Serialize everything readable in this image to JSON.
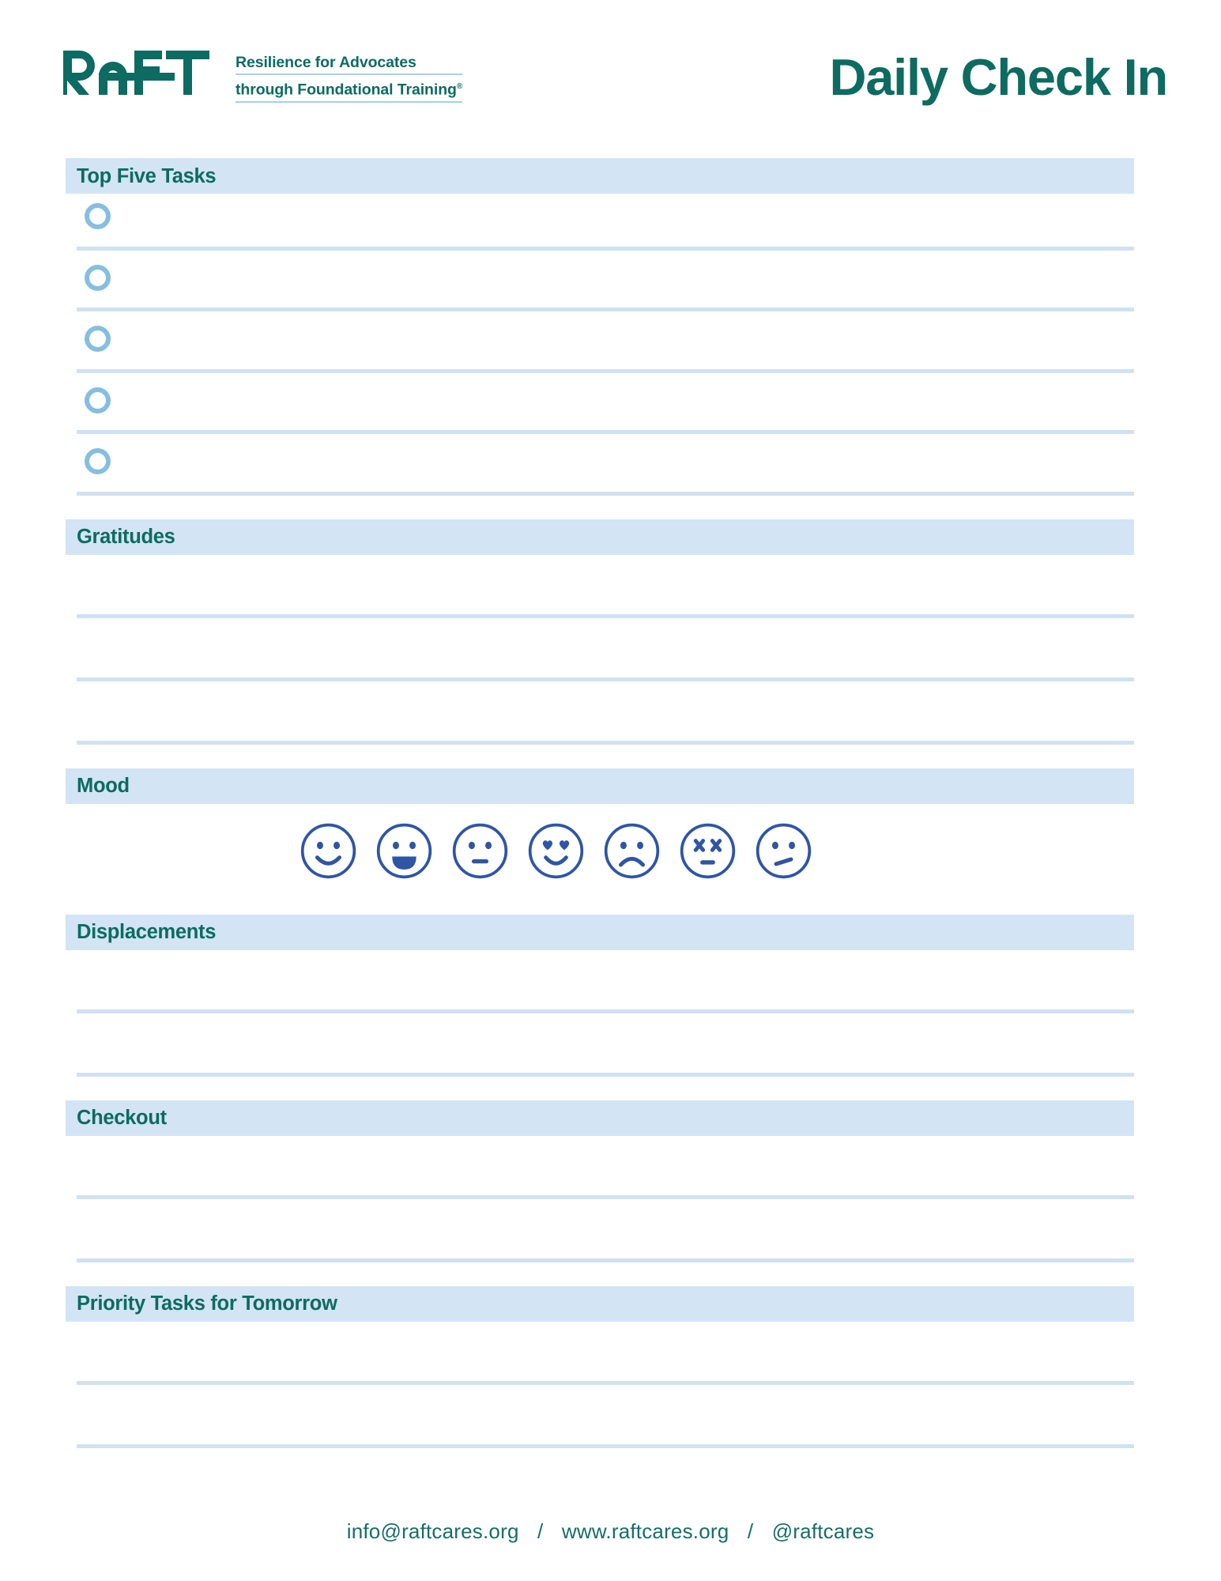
{
  "document": {
    "title": "Daily Check In",
    "accent_green": "#0d6b61",
    "band_blue": "#d3e4f4",
    "rule_blue": "#cfe2f2",
    "circle_blue": "#86bee0",
    "face_blue": "#2f55a4"
  },
  "logo": {
    "wordmark": "RAFT",
    "tagline_line1": "Resilience for Advocates",
    "tagline_line2": "through Foundational Training",
    "registered_mark": "®"
  },
  "sections": {
    "top_five_tasks": {
      "heading": "Top Five Tasks",
      "rows": 5
    },
    "gratitudes": {
      "heading": "Gratitudes",
      "lines": 3
    },
    "mood": {
      "heading": "Mood",
      "faces": [
        {
          "name": "smiling-face",
          "label": "Smiling"
        },
        {
          "name": "grinning-face",
          "label": "Grinning"
        },
        {
          "name": "neutral-face",
          "label": "Neutral"
        },
        {
          "name": "heart-eyes-face",
          "label": "Heart Eyes"
        },
        {
          "name": "frowning-face",
          "label": "Frowning"
        },
        {
          "name": "dizzy-face",
          "label": "Dizzy"
        },
        {
          "name": "confused-face",
          "label": "Confused"
        }
      ]
    },
    "displacements": {
      "heading": "Displacements",
      "lines": 2
    },
    "checkout": {
      "heading": "Checkout",
      "lines": 2
    },
    "priority_tasks_tomorrow": {
      "heading": "Priority Tasks for Tomorrow",
      "lines": 2
    }
  },
  "footer": {
    "email": "info@raftcares.org",
    "separator": "/",
    "website": "www.raftcares.org",
    "social": "@raftcares"
  }
}
